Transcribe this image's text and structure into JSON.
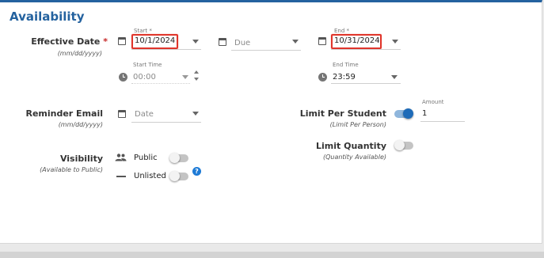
{
  "section": {
    "title": "Availability"
  },
  "effective_date": {
    "label": "Effective Date",
    "required_mark": "*",
    "format_hint": "(mm/dd/yyyy)",
    "start_caption": "Start *",
    "start_value": "10/1/2024",
    "due_placeholder": "Due",
    "end_caption": "End *",
    "end_value": "10/31/2024",
    "start_time_caption": "Start Time",
    "start_time_value": "00:00",
    "end_time_caption": "End Time",
    "end_time_value": "23:59"
  },
  "reminder_email": {
    "label": "Reminder Email",
    "format_hint": "(mm/dd/yyyy)",
    "date_placeholder": "Date"
  },
  "limit_per_student": {
    "label": "Limit Per Student",
    "sub": "(Limit Per Person)",
    "enabled": true,
    "amount_caption": "Amount",
    "amount_value": "1"
  },
  "limit_quantity": {
    "label": "Limit Quantity",
    "sub": "(Quantity Available)",
    "enabled": false
  },
  "visibility": {
    "label": "Visibility",
    "sub": "(Available to Public)",
    "options": [
      {
        "label": "Public",
        "icon": "people-icon",
        "enabled": false
      },
      {
        "label": "Unlisted",
        "icon": "dash-icon",
        "enabled": false
      }
    ],
    "help_glyph": "?"
  },
  "colors": {
    "accent": "#24629f",
    "highlight": "#e0352b",
    "toggle_on": "#1e6bb8"
  }
}
